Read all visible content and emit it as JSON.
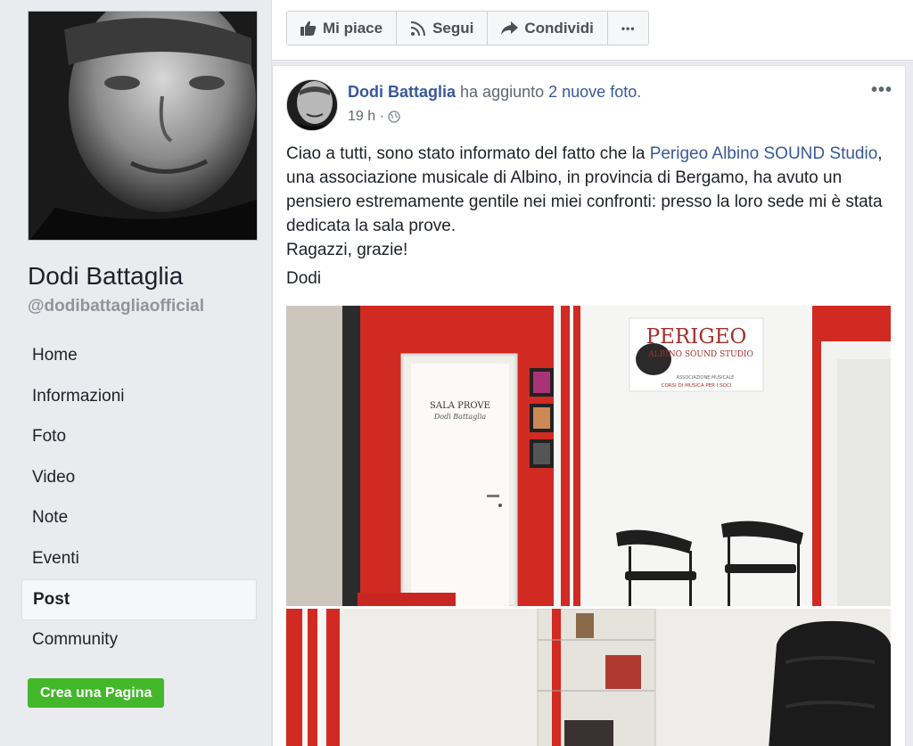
{
  "profile": {
    "name": "Dodi Battaglia",
    "handle": "@dodibattagliaofficial"
  },
  "nav": {
    "items": [
      {
        "label": "Home"
      },
      {
        "label": "Informazioni"
      },
      {
        "label": "Foto"
      },
      {
        "label": "Video"
      },
      {
        "label": "Note"
      },
      {
        "label": "Eventi"
      },
      {
        "label": "Post",
        "active": true
      },
      {
        "label": "Community"
      }
    ],
    "create_page_label": "Crea una Pagina"
  },
  "actions": {
    "like_label": "Mi piace",
    "follow_label": "Segui",
    "share_label": "Condividi",
    "more_label": "•••"
  },
  "post": {
    "author": "Dodi Battaglia",
    "action_text": "ha aggiunto",
    "photos_link": "2 nuove foto",
    "timestamp": "19 h",
    "more_label": "•••",
    "text_part1": "Ciao a tutti, sono stato informato del fatto che la ",
    "text_link": "Perigeo Albino SOUND Studio",
    "text_part2": ", una associazione musicale di Albino, in provincia di Bergamo, ha avuto un pensiero estremamente gentile nei miei confronti: presso la loro sede mi è stata dedicata la sala prove.",
    "text_line2": "Ragazzi, grazie!",
    "signoff": "Dodi"
  },
  "photo": {
    "sign_title": "PERIGEO",
    "sign_subtitle": "ALBINO SOUND STUDIO",
    "sign_small1": "ASSOCIAZIONE MUSICALE",
    "sign_small2": "CORSI DI MUSICA PER I SOCI",
    "door_label": "SALA PROVE",
    "door_signature": "Dodi Battaglia"
  },
  "colors": {
    "link": "#385898",
    "green_button": "#42b72a",
    "wall_red": "#d02a22"
  }
}
